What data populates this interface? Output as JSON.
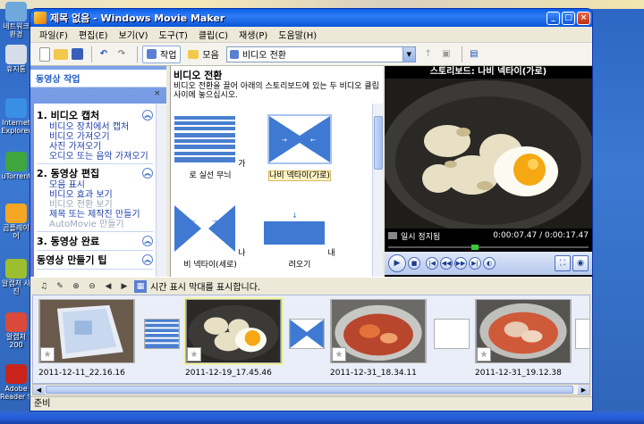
{
  "window": {
    "title": "제목 없음 - Windows Movie Maker",
    "min": "_",
    "max": "□",
    "close": "×"
  },
  "desktop_icons": [
    {
      "label": "네트워크 환경",
      "color": "#6fa8dc"
    },
    {
      "label": "휴지통",
      "color": "#d6dde8"
    },
    {
      "label": "Internet Explorer",
      "color": "#3a8ee6"
    },
    {
      "label": "uTorrent",
      "color": "#3fa53f"
    },
    {
      "label": "곰플레이어",
      "color": "#f5a623"
    },
    {
      "label": "알캡처 사진",
      "color": "#9bbf2e"
    },
    {
      "label": "알캡처 200",
      "color": "#d94a3a"
    },
    {
      "label": "Adobe Reader 9",
      "color": "#c9241b"
    }
  ],
  "menu": [
    "파일(F)",
    "편집(E)",
    "보기(V)",
    "도구(T)",
    "클립(C)",
    "재생(P)",
    "도움말(H)"
  ],
  "toolbar": {
    "new_icon": "new-file-icon",
    "open_icon": "open-folder-icon",
    "save_icon": "save-disk-icon",
    "undo_icon": "undo-icon",
    "redo_icon": "redo-icon",
    "tasks_label": "작업",
    "collections_label": "모음",
    "combo_value": "비디오 전환"
  },
  "taskpane": {
    "header": "동영상 작업",
    "sections": [
      {
        "title": "1. 비디오 캡처",
        "links": [
          {
            "label": "비디오 장치에서 캡처",
            "enabled": true
          },
          {
            "label": "비디오 가져오기",
            "enabled": true
          },
          {
            "label": "사진 가져오기",
            "enabled": true
          },
          {
            "label": "오디오 또는 음악 가져오기",
            "enabled": true
          }
        ]
      },
      {
        "title": "2. 동영상 편집",
        "links": [
          {
            "label": "모음 표시",
            "enabled": true
          },
          {
            "label": "비디오 효과 보기",
            "enabled": true
          },
          {
            "label": "비디오 전환 보기",
            "enabled": false
          },
          {
            "label": "제목 또는 제작진 만들기",
            "enabled": true
          },
          {
            "label": "AutoMovie 만들기",
            "enabled": false
          }
        ]
      },
      {
        "title": "3. 동영상 완료",
        "links": []
      },
      {
        "title": "동영상 만들기 팁",
        "links": []
      }
    ]
  },
  "content": {
    "title": "비디오 전환",
    "description": "비디오 전환을 끌어 아래의 스토리보드에 있는 두 비디오 클립 사이에 놓으십시오.",
    "tiles": [
      {
        "label": "가로 실선 무늬",
        "selected": false
      },
      {
        "label": "나비 넥타이(가로)",
        "selected": true
      },
      {
        "label": "나비 넥타이(세로)",
        "selected": false
      },
      {
        "label": "내려오기",
        "selected": false
      }
    ]
  },
  "monitor": {
    "title": "스토리보드: 나비 넥타이(가로)",
    "status_left": "일시 정지됨",
    "time": "0:00:07.47 / 0:00:17.47",
    "progress_fraction": 0.43
  },
  "storyboard_toolbar": {
    "hint": "시간 표시 막대를 표시합니다."
  },
  "storyboard": {
    "clips": [
      {
        "label": "2011-12-11_22.16.16",
        "kind": "box",
        "selected": false
      },
      {
        "label": "2011-12-19_17.45.46",
        "kind": "egg",
        "selected": true
      },
      {
        "label": "2011-12-31_18.34.11",
        "kind": "kimchi",
        "selected": false
      },
      {
        "label": "2011-12-31_19.12.38",
        "kind": "pot",
        "selected": false
      }
    ]
  },
  "status": {
    "text": "준비"
  }
}
